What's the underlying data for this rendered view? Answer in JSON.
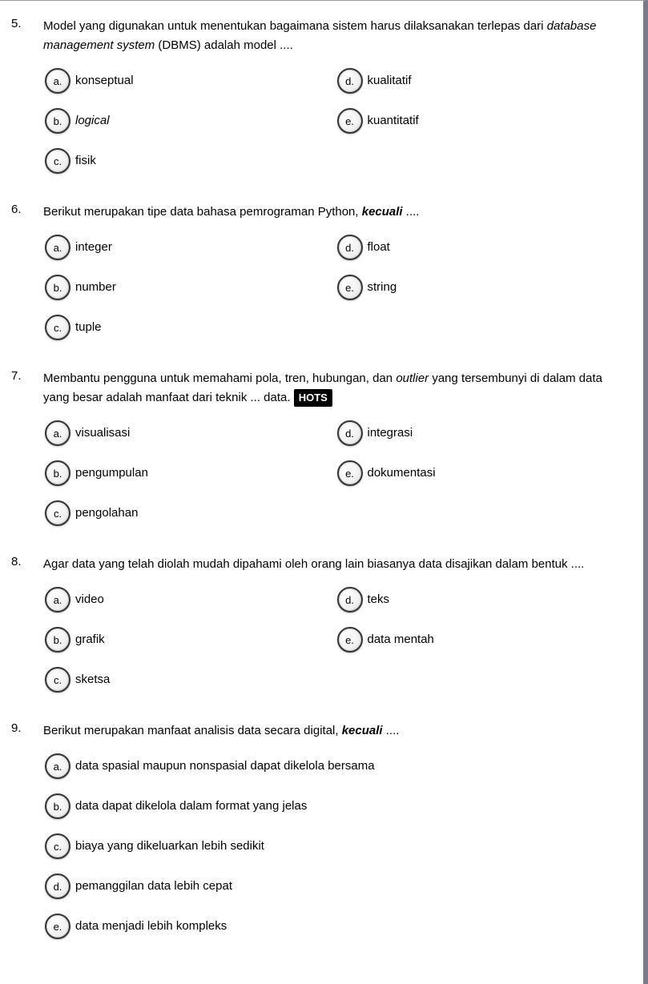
{
  "questions": [
    {
      "number": "5.",
      "text_parts": [
        {
          "t": "Model yang digunakan untuk menentukan bagaimana sistem harus dilaksanakan terlepas dari "
        },
        {
          "t": "database management system",
          "style": "italic"
        },
        {
          "t": " (DBMS) adalah model ...."
        }
      ],
      "layout": "two-col",
      "options": [
        {
          "letter": "a.",
          "label_parts": [
            {
              "t": "konseptual"
            }
          ]
        },
        {
          "letter": "d.",
          "label_parts": [
            {
              "t": "kualitatif"
            }
          ]
        },
        {
          "letter": "b.",
          "label_parts": [
            {
              "t": "logical",
              "style": "italic"
            }
          ]
        },
        {
          "letter": "e.",
          "label_parts": [
            {
              "t": "kuantitatif"
            }
          ]
        },
        {
          "letter": "c.",
          "label_parts": [
            {
              "t": "fisik"
            }
          ]
        }
      ]
    },
    {
      "number": "6.",
      "text_parts": [
        {
          "t": "Berikut merupakan tipe data bahasa pemrograman Python, "
        },
        {
          "t": "kecuali",
          "style": "bolditalic"
        },
        {
          "t": " ...."
        }
      ],
      "layout": "two-col",
      "options": [
        {
          "letter": "a.",
          "label_parts": [
            {
              "t": "integer"
            }
          ]
        },
        {
          "letter": "d.",
          "label_parts": [
            {
              "t": "float"
            }
          ]
        },
        {
          "letter": "b.",
          "label_parts": [
            {
              "t": "number"
            }
          ]
        },
        {
          "letter": "e.",
          "label_parts": [
            {
              "t": "string"
            }
          ]
        },
        {
          "letter": "c.",
          "label_parts": [
            {
              "t": "tuple"
            }
          ]
        }
      ]
    },
    {
      "number": "7.",
      "text_parts": [
        {
          "t": "Membantu pengguna untuk memahami pola, tren, hubungan, dan "
        },
        {
          "t": "outlier",
          "style": "italic"
        },
        {
          "t": " yang tersembunyi di dalam data yang besar adalah manfaat dari teknik ... data. "
        },
        {
          "t": "HOTS",
          "style": "hots"
        }
      ],
      "layout": "two-col",
      "options": [
        {
          "letter": "a.",
          "label_parts": [
            {
              "t": "visualisasi"
            }
          ]
        },
        {
          "letter": "d.",
          "label_parts": [
            {
              "t": "integrasi"
            }
          ]
        },
        {
          "letter": "b.",
          "label_parts": [
            {
              "t": "pengumpulan"
            }
          ]
        },
        {
          "letter": "e.",
          "label_parts": [
            {
              "t": "dokumentasi"
            }
          ]
        },
        {
          "letter": "c.",
          "label_parts": [
            {
              "t": "pengolahan"
            }
          ]
        }
      ]
    },
    {
      "number": "8.",
      "text_parts": [
        {
          "t": "Agar data yang telah diolah mudah dipahami oleh orang lain biasanya data disajikan dalam bentuk ...."
        }
      ],
      "layout": "two-col",
      "options": [
        {
          "letter": "a.",
          "label_parts": [
            {
              "t": "video"
            }
          ]
        },
        {
          "letter": "d.",
          "label_parts": [
            {
              "t": "teks"
            }
          ]
        },
        {
          "letter": "b.",
          "label_parts": [
            {
              "t": "grafik"
            }
          ]
        },
        {
          "letter": "e.",
          "label_parts": [
            {
              "t": "data mentah"
            }
          ]
        },
        {
          "letter": "c.",
          "label_parts": [
            {
              "t": "sketsa"
            }
          ]
        }
      ]
    },
    {
      "number": "9.",
      "text_parts": [
        {
          "t": "Berikut merupakan manfaat analisis data secara digital, "
        },
        {
          "t": "kecuali",
          "style": "bolditalic"
        },
        {
          "t": " ...."
        }
      ],
      "layout": "one-col",
      "options": [
        {
          "letter": "a.",
          "label_parts": [
            {
              "t": "data spasial maupun nonspasial dapat dikelola bersama"
            }
          ]
        },
        {
          "letter": "b.",
          "label_parts": [
            {
              "t": "data dapat dikelola dalam format yang jelas"
            }
          ]
        },
        {
          "letter": "c.",
          "label_parts": [
            {
              "t": "biaya yang dikeluarkan lebih sedikit"
            }
          ]
        },
        {
          "letter": "d.",
          "label_parts": [
            {
              "t": "pemanggilan data lebih cepat"
            }
          ]
        },
        {
          "letter": "e.",
          "label_parts": [
            {
              "t": "data menjadi lebih kompleks"
            }
          ]
        }
      ]
    }
  ]
}
